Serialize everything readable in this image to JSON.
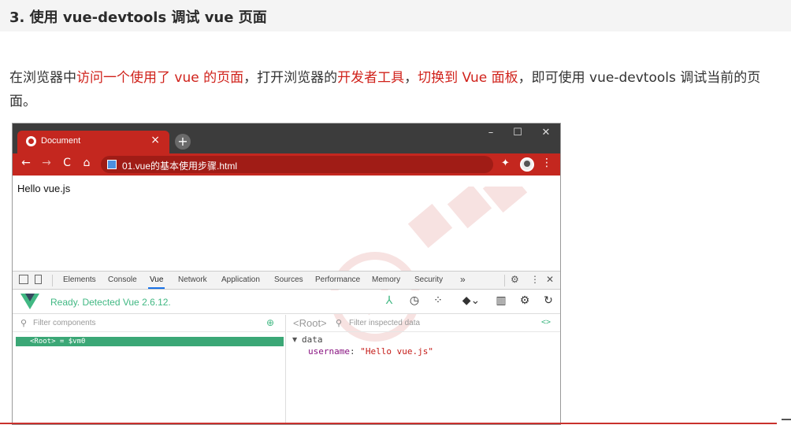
{
  "section": {
    "title": "3. 使用 vue-devtools 调试 vue 页面"
  },
  "intro": {
    "p1": "在浏览器中",
    "h1": "访问一个使用了 vue 的页面",
    "p2": "，打开浏览器的",
    "h2": "开发者工具",
    "p3": "，",
    "h3": "切换到 Vue 面板",
    "p4": "，即可使用 vue-devtools 调试当前的页面。"
  },
  "browser": {
    "tab_title": "Document",
    "tab_close": "×",
    "new_tab": "+",
    "window_controls": {
      "minimize": "–",
      "maximize": "☐",
      "close": "✕"
    },
    "nav": {
      "back": "←",
      "forward": "→",
      "reload": "C",
      "home": "⌂"
    },
    "url": "01.vue的基本使用步骤.html",
    "page_text": "Hello vue.js"
  },
  "devtools": {
    "tabs": [
      "Elements",
      "Console",
      "Vue",
      "Network",
      "Application",
      "Sources",
      "Performance",
      "Memory",
      "Security"
    ],
    "active_tab": "Vue",
    "more": "»",
    "settings": "⚙",
    "kebab": "⋮",
    "close": "✕"
  },
  "vue_panel": {
    "status": "Ready. Detected Vue 2.6.12.",
    "tools": [
      "components-icon",
      "history-icon",
      "vuex-icon",
      "routing-icon",
      "performance-icon",
      "settings-icon",
      "refresh-icon"
    ],
    "left": {
      "filter_placeholder": "Filter components",
      "root_row": "<Root> = $vm0"
    },
    "right": {
      "root_label": "<Root>",
      "filter_placeholder": "Filter inspected data",
      "code_toggle": "<>",
      "section": "data",
      "prop_name": "username",
      "prop_value": "\"Hello vue.js\""
    }
  },
  "colors": {
    "accent_red": "#c4271f",
    "highlight_red": "#d0221b",
    "vue_green": "#41b883",
    "root_row_green": "#3ba776"
  }
}
